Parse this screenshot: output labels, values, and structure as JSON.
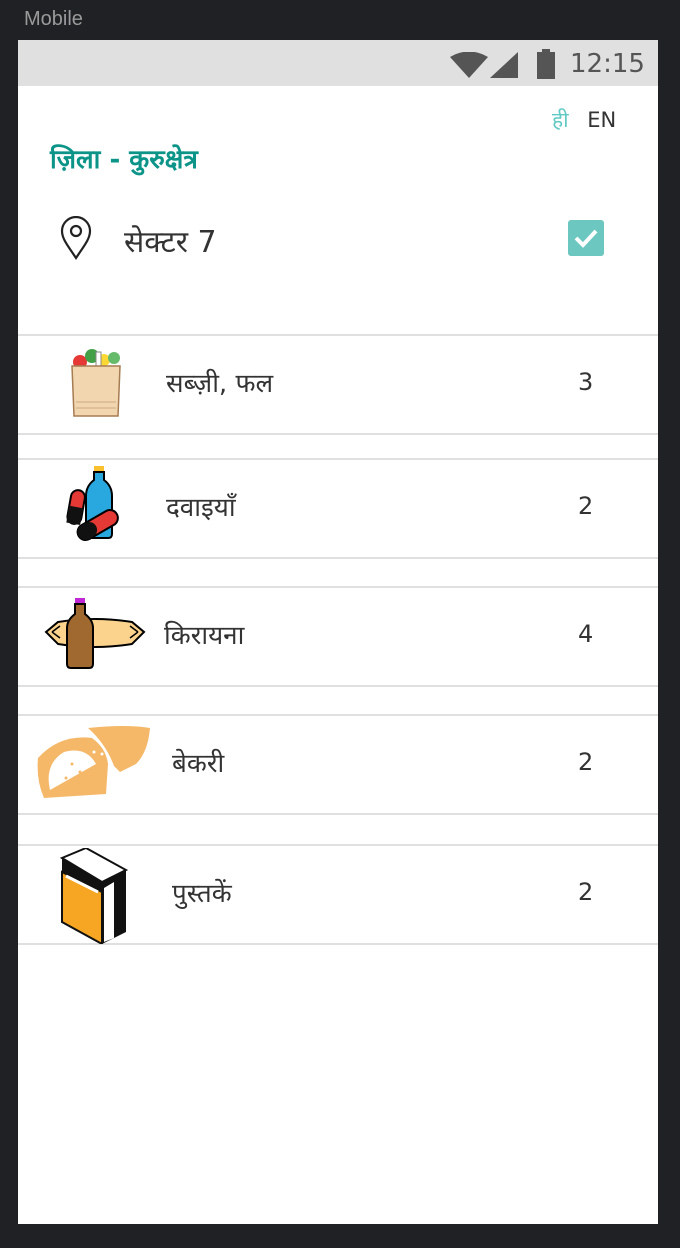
{
  "window": {
    "title": "Mobile"
  },
  "status_bar": {
    "time": "12:15",
    "icons": [
      "wifi-icon",
      "cell-signal-icon",
      "battery-icon"
    ]
  },
  "language": {
    "hindi": "ही",
    "english": "EN"
  },
  "district_label": "ज़िला  - कुरुक्षेत्र",
  "location": {
    "name": "सेक्टर  7",
    "icon": "map-pin-icon",
    "checked": true
  },
  "categories": [
    {
      "label": "सब्ज़ी, फल",
      "count": "3",
      "icon": "grocery-bag-icon"
    },
    {
      "label": "दवाइयाँ",
      "count": "2",
      "icon": "medicine-icon"
    },
    {
      "label": "किरायना",
      "count": "4",
      "icon": "grocery-staples-icon"
    },
    {
      "label": "बेकरी",
      "count": "2",
      "icon": "bread-icon"
    },
    {
      "label": "पुस्तकें",
      "count": "2",
      "icon": "book-icon"
    }
  ],
  "colors": {
    "accent": "#0d9488",
    "checkbox": "#6cc7c1",
    "language_active": "#5fc9c4"
  }
}
